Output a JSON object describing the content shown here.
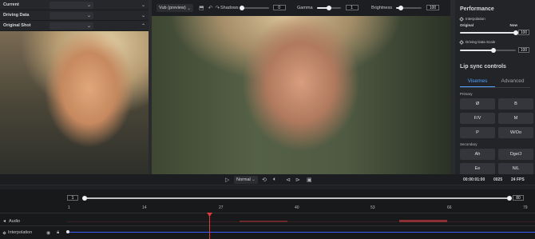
{
  "left_panel": {
    "sections": [
      {
        "label": "Current"
      },
      {
        "label": "Driving Data"
      },
      {
        "label": "Original Shot"
      }
    ]
  },
  "viewer_toolbar": {
    "view_select": "Vub (preview)",
    "shadows": {
      "label": "Shadows",
      "value": "0",
      "level": 0.0
    },
    "gamma": {
      "label": "Gamma",
      "value": "1",
      "level": 0.5
    },
    "brightness": {
      "label": "Brightness",
      "value": "100",
      "level": 0.2
    }
  },
  "performance": {
    "title": "Performance",
    "interpolation_label": "Interpolation",
    "original_label": "Original",
    "now_label": "Now",
    "interpolation_value": "100",
    "interpolation_level": 1.0,
    "driving_scale_label": "Driving Data Scale",
    "driving_scale_value": "100",
    "driving_scale_level": 0.6
  },
  "lip_sync": {
    "title": "Lip sync controls",
    "tabs": [
      "Visemes",
      "Advanced"
    ],
    "active_tab": "Visemes",
    "primary_label": "Primary",
    "primary_buttons": [
      "Ø",
      "B",
      "F/V",
      "M",
      "P",
      "W/Oo"
    ],
    "secondary_label": "Secondary",
    "secondary_buttons": [
      "Ah",
      "Dge/J",
      "Ee",
      "N/L"
    ]
  },
  "transport": {
    "speed": "Normal",
    "timecode": "00:00:01:00",
    "frame": "0025",
    "fps": "24 FPS"
  },
  "timeline": {
    "range_start": "1",
    "range_end": "80",
    "ticks": [
      "1",
      "14",
      "27",
      "40",
      "53",
      "66",
      "79"
    ],
    "tracks": [
      {
        "label": "Audio"
      },
      {
        "label": "Interpolation"
      }
    ]
  },
  "colors": {
    "accent": "#4da3ff",
    "playhead": "#e23b3b",
    "interp_line": "#3b5cff"
  }
}
